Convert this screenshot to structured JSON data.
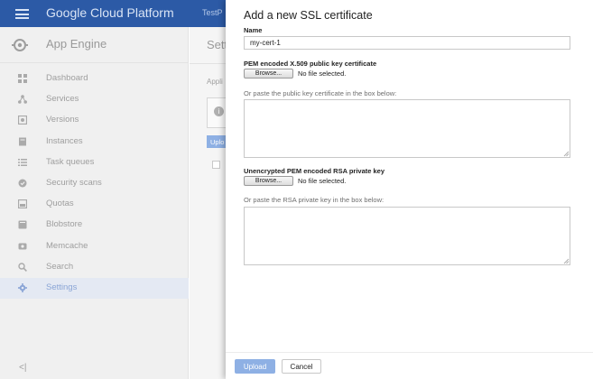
{
  "topbar": {
    "brand": "Google Cloud Platform",
    "project_partial": "TestP",
    "menu_icon": "hamburger-icon"
  },
  "sidebar": {
    "product_title": "App Engine",
    "product_icon": "app-engine-icon",
    "items": [
      {
        "label": "Dashboard",
        "icon": "dashboard-icon",
        "active": false
      },
      {
        "label": "Services",
        "icon": "services-icon",
        "active": false
      },
      {
        "label": "Versions",
        "icon": "versions-icon",
        "active": false
      },
      {
        "label": "Instances",
        "icon": "instances-icon",
        "active": false
      },
      {
        "label": "Task queues",
        "icon": "task-queues-icon",
        "active": false
      },
      {
        "label": "Security scans",
        "icon": "security-scans-icon",
        "active": false
      },
      {
        "label": "Quotas",
        "icon": "quotas-icon",
        "active": false
      },
      {
        "label": "Blobstore",
        "icon": "blobstore-icon",
        "active": false
      },
      {
        "label": "Memcache",
        "icon": "memcache-icon",
        "active": false
      },
      {
        "label": "Search",
        "icon": "search-icon",
        "active": false
      },
      {
        "label": "Settings",
        "icon": "settings-gear-icon",
        "active": true
      }
    ],
    "collapse_glyph": "<|"
  },
  "main": {
    "title_partial": "Setti",
    "applic_partial": "Appli",
    "upload_partial": "Uplo"
  },
  "dialog": {
    "title": "Add a new SSL certificate",
    "name_label": "Name",
    "name_value": "my-cert-1",
    "cert_label": "PEM encoded X.509 public key certificate",
    "browse_label": "Browse...",
    "no_file": "No file selected.",
    "cert_paste_hint": "Or paste the public key certificate in the box below:",
    "key_label": "Unencrypted PEM encoded RSA private key",
    "key_paste_hint": "Or paste the RSA private key in the box below:",
    "upload_label": "Upload",
    "cancel_label": "Cancel"
  },
  "colors": {
    "topbar": "#2c5aa6",
    "sidebar_bg": "#f0f0f0",
    "active_item": "#8aa5d6",
    "primary_button": "#8eb0e4"
  }
}
